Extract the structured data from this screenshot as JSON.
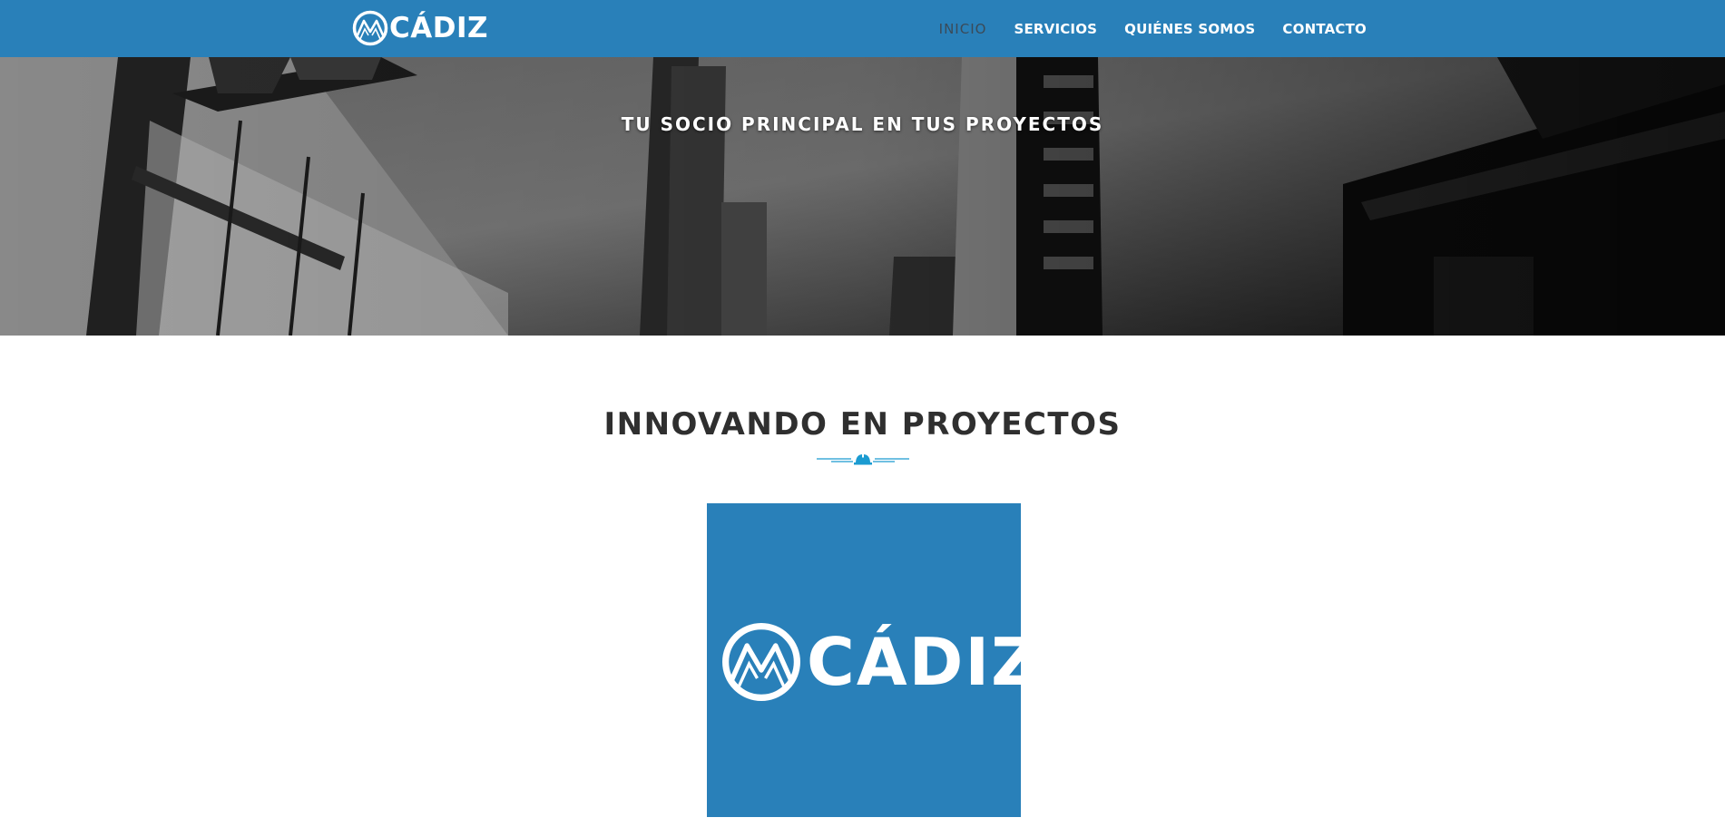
{
  "header": {
    "brand_name": "CÁDIZ",
    "nav": [
      {
        "label": "INICIO",
        "active": true
      },
      {
        "label": "SERVICIOS",
        "active": false
      },
      {
        "label": "QUIÉNES SOMOS",
        "active": false
      },
      {
        "label": "CONTACTO",
        "active": false
      }
    ]
  },
  "hero": {
    "tagline": "TU SOCIO PRINCIPAL EN TUS PROYECTOS"
  },
  "main": {
    "section_title": "INNOVANDO EN PROYECTOS",
    "logo_text": "CÁDIZ"
  },
  "colors": {
    "brand_blue": "#2980b9",
    "active_nav": "#3b4a58",
    "divider_accent": "#1b9bd1",
    "title_text": "#2f2f2f"
  },
  "icons": {
    "brand_mark": "mountain-circle-logo-icon",
    "divider": "helmet-divider-icon"
  }
}
